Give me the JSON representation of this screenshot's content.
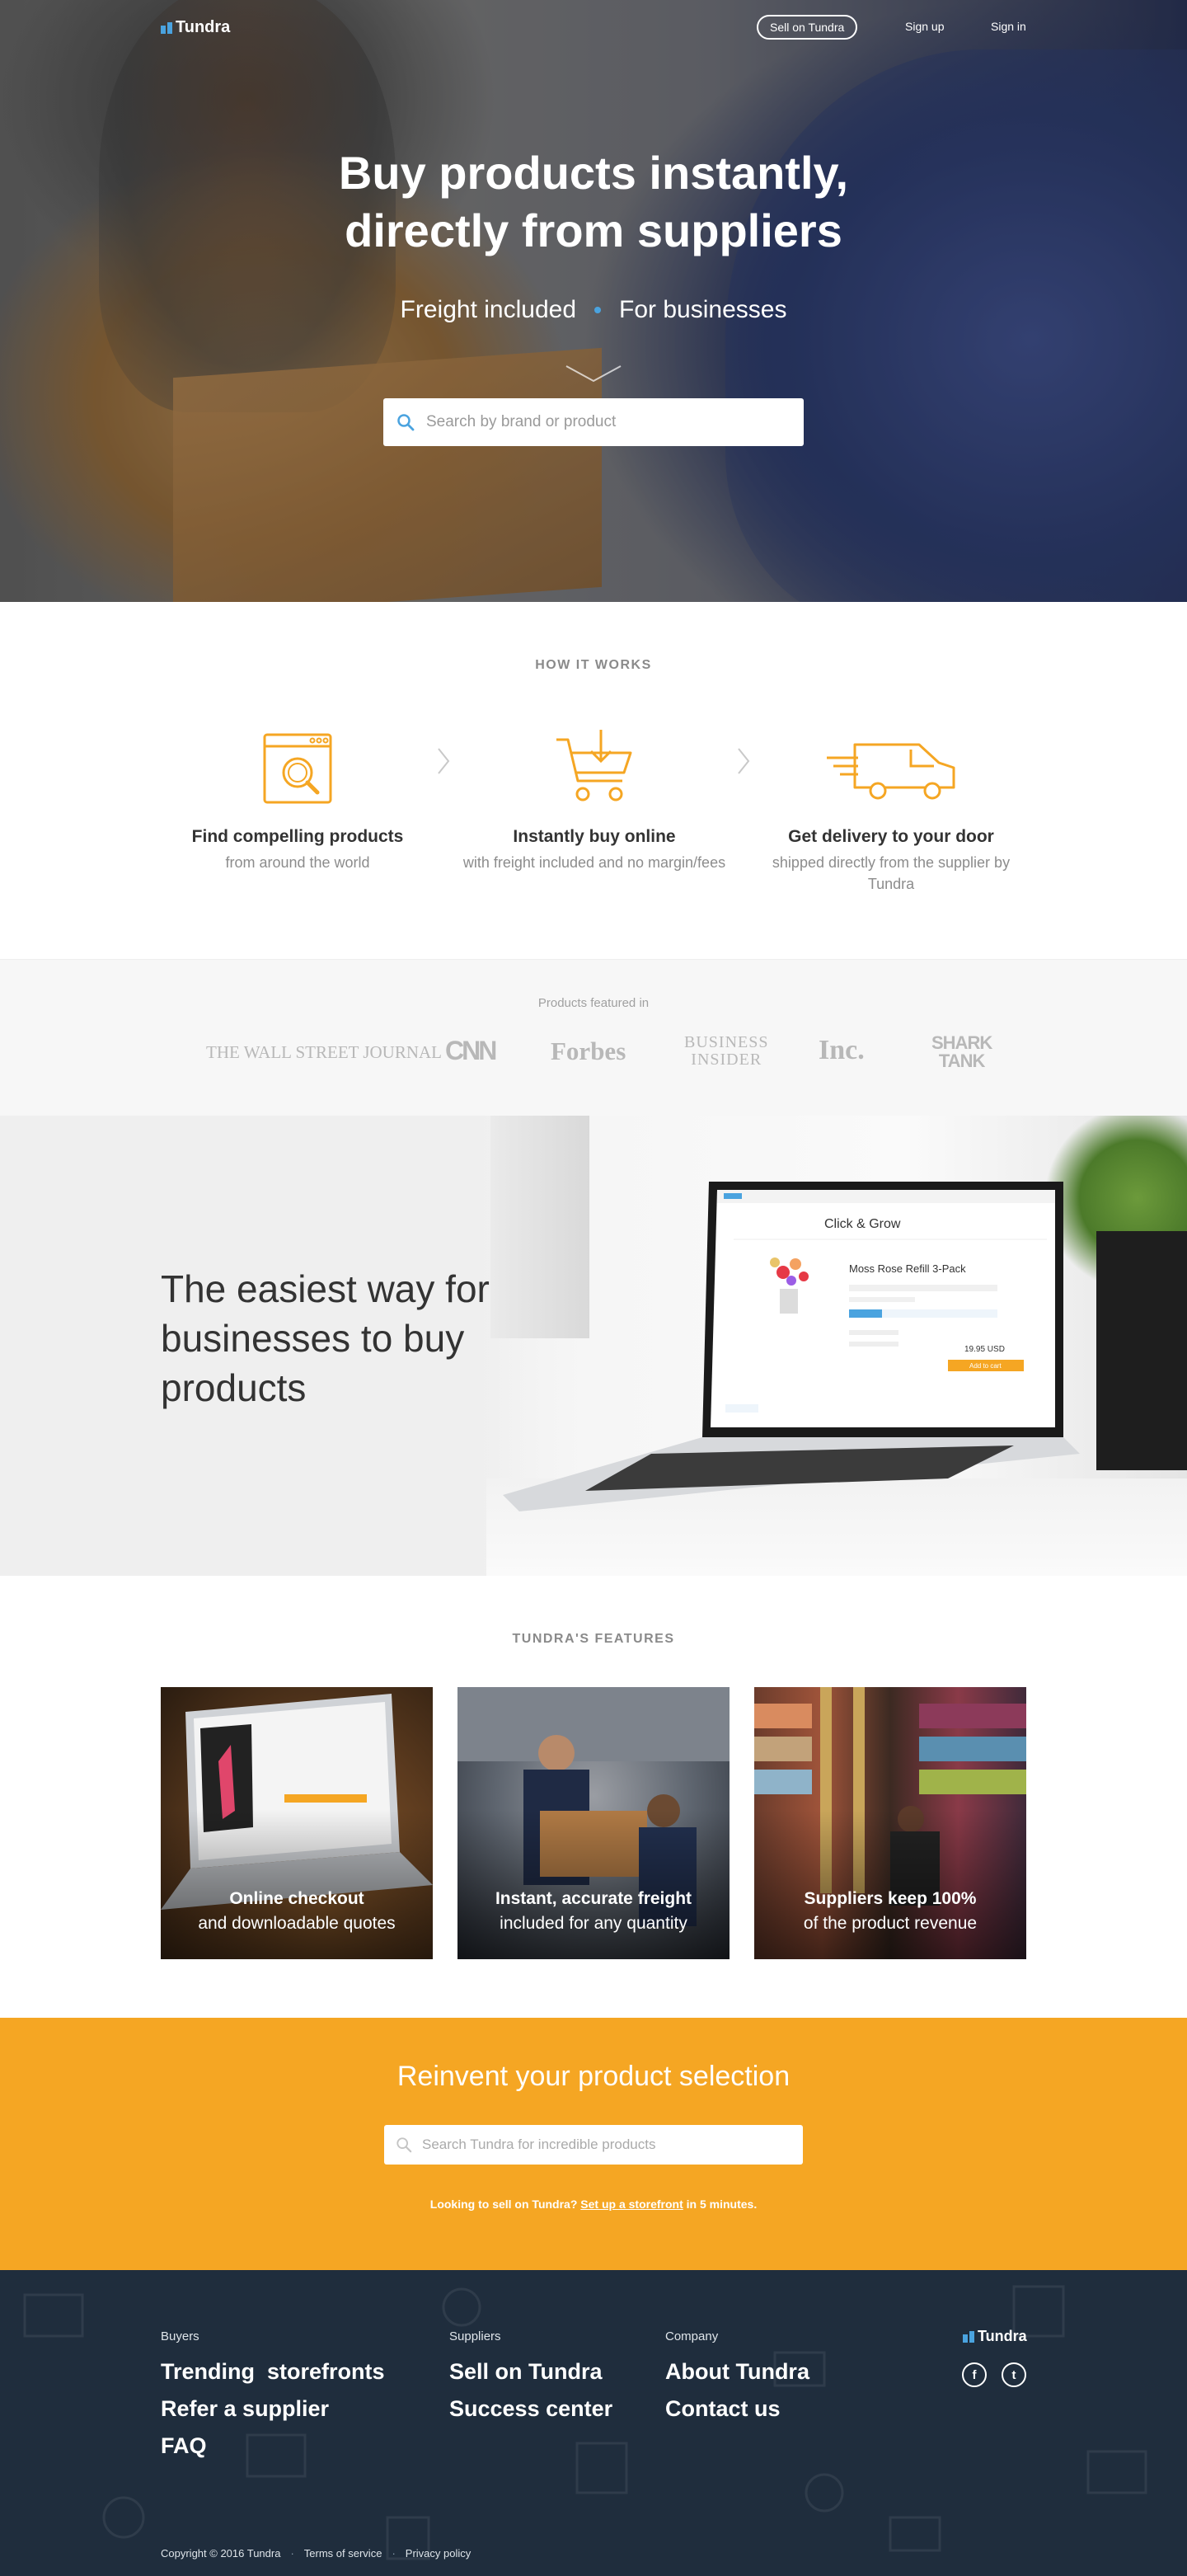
{
  "brand": {
    "name": "Tundra",
    "accent": "#4aa3df",
    "orange": "#f5a623",
    "footer_bg": "#1f2d3d"
  },
  "nav": {
    "sell": "Sell on Tundra",
    "signup": "Sign up",
    "signin": "Sign in"
  },
  "hero": {
    "title_line1": "Buy products instantly,",
    "title_line2": "directly from suppliers",
    "sub1": "Freight included",
    "sub2": "For businesses",
    "search_placeholder": "Search by brand or product"
  },
  "how": {
    "label": "HOW IT WORKS",
    "steps": [
      {
        "icon": "browser-search-icon",
        "title": "Find compelling products",
        "desc": "from around the world"
      },
      {
        "icon": "cart-download-icon",
        "title": "Instantly buy online",
        "desc": "with freight included and no margin/fees"
      },
      {
        "icon": "delivery-truck-icon",
        "title": "Get delivery to your door",
        "desc": "shipped directly from the supplier by Tundra"
      }
    ]
  },
  "featured": {
    "label": "Products featured in",
    "logos": [
      "THE WALL STREET JOURNAL",
      "CNN",
      "Forbes",
      "BUSINESS",
      "INSIDER",
      "Inc.",
      "SHARK",
      "TANK"
    ]
  },
  "easiest": {
    "headline": "The easiest way for businesses to buy products",
    "screen": {
      "shop": "Click & Grow",
      "product": "Moss Rose Refill 3-Pack",
      "price": "19.95 USD",
      "add": "Add to cart"
    }
  },
  "features": {
    "label": "TUNDRA'S FEATURES",
    "cards": [
      {
        "title": "Online checkout",
        "sub": "and downloadable quotes"
      },
      {
        "title": "Instant, accurate freight",
        "sub": "included for any quantity"
      },
      {
        "title": "Suppliers keep 100%",
        "sub": "of the product revenue"
      }
    ]
  },
  "cta": {
    "title": "Reinvent your product selection",
    "search_placeholder": "Search Tundra for incredible products",
    "note_prefix": "Looking to sell on Tundra? ",
    "note_link": "Set up a storefront",
    "note_suffix": " in 5 minutes."
  },
  "footer": {
    "buyers": {
      "head": "Buyers",
      "links": [
        "Trending  storefronts",
        "Refer a supplier",
        "FAQ"
      ]
    },
    "suppliers": {
      "head": "Suppliers",
      "links": [
        "Sell on Tundra",
        "Success center"
      ]
    },
    "company": {
      "head": "Company",
      "links": [
        "About Tundra",
        "Contact us"
      ]
    },
    "logo": "Tundra",
    "social": {
      "facebook": "f",
      "twitter": "t"
    },
    "copyright": "Copyright © 2016 Tundra",
    "terms": "Terms of service",
    "privacy": "Privacy policy"
  }
}
